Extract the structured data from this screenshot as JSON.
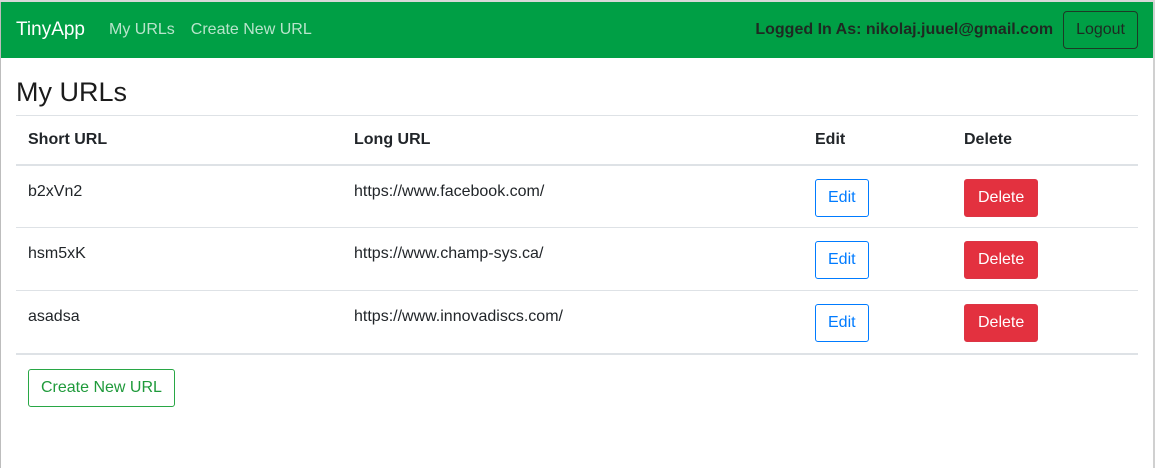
{
  "navbar": {
    "brand": "TinyApp",
    "links": [
      "My URLs",
      "Create New URL"
    ],
    "logged_in_text": "Logged In As: nikolaj.juuel@gmail.com",
    "logout_label": "Logout",
    "bg_color": "#009f45"
  },
  "page": {
    "title": "My URLs"
  },
  "table": {
    "headers": [
      "Short URL",
      "Long URL",
      "Edit",
      "Delete"
    ],
    "rows": [
      {
        "short": "b2xVn2",
        "long": "https://www.facebook.com/",
        "edit_label": "Edit",
        "delete_label": "Delete"
      },
      {
        "short": "hsm5xK",
        "long": "https://www.champ-sys.ca/",
        "edit_label": "Edit",
        "delete_label": "Delete"
      },
      {
        "short": "asadsa",
        "long": "https://www.innovadiscs.com/",
        "edit_label": "Edit",
        "delete_label": "Delete"
      }
    ]
  },
  "create_button_label": "Create New URL",
  "colors": {
    "edit": "#007bff",
    "delete": "#e3313f",
    "create": "#28a745"
  }
}
